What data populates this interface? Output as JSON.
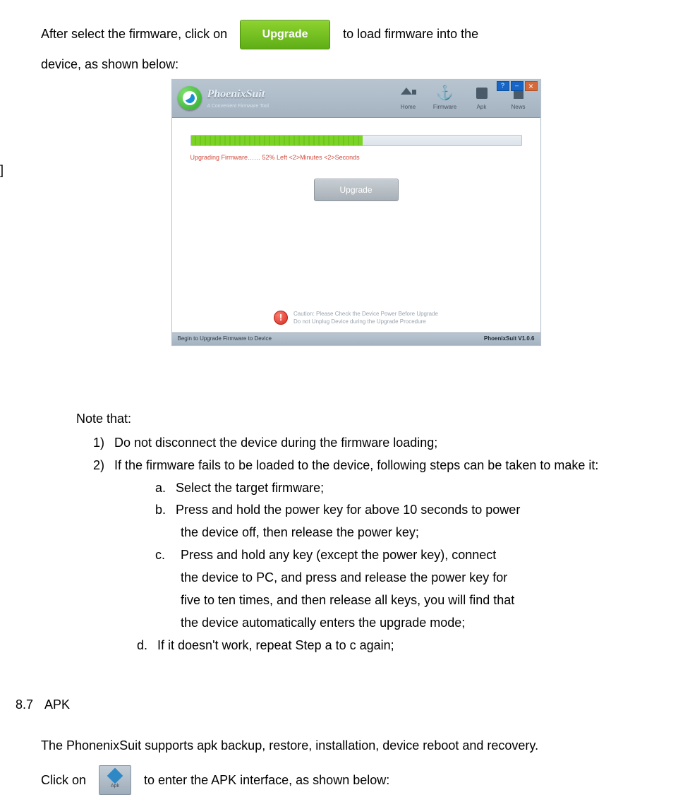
{
  "stray": "]",
  "para1_a": "After select the firmware, click on",
  "upgrade_label": "Upgrade",
  "para1_b": "to load firmware into the",
  "para1_c": "device, as shown below:",
  "app": {
    "brand": "PhoenixSuit",
    "brand_sub": "A Convenient Firmware Tool",
    "nav": {
      "home": "Home",
      "firmware": "Firmware",
      "apk": "Apk",
      "news": "News"
    },
    "progress_pct": 52,
    "progress_text": "Upgrading Firmware…… 52%   Left <2>Minutes <2>Seconds",
    "upgrade_btn": "Upgrade",
    "caution1": "Caution: Please Check the Device Power Before Upgrade",
    "caution2": "Do not Unplug Device during the Upgrade Procedure",
    "status_left": "Begin to Upgrade Firmware to Device",
    "status_right": "PhoenixSuit V1.0.6"
  },
  "note_title": "Note that:",
  "n1": "Do not disconnect the device during the firmware loading;",
  "n2": "If the firmware fails to be loaded to the device, following steps can be taken to make it:",
  "na": "Select the target firmware;",
  "nb": "Press and hold the power key for above 10 seconds to power",
  "nb2": "the device off, then release the power key;",
  "nc": "Press and hold any key (except the power key), connect",
  "nc2": "the device to PC, and press and release the power key for",
  "nc3": "five to ten times, and then release all keys, you will find that",
  "nc4": "the device automatically enters the upgrade mode;",
  "nd": "If it doesn't work, repeat Step a to c again;",
  "sec87_num": "8.7",
  "sec87_title": "APK",
  "p87": "The PhonenixSuit supports apk backup, restore, installation, device reboot and recovery.",
  "p87b_a": "Click on",
  "apk_icon_label": "Apk",
  "p87b_b": "to enter the APK interface, as shown below:"
}
